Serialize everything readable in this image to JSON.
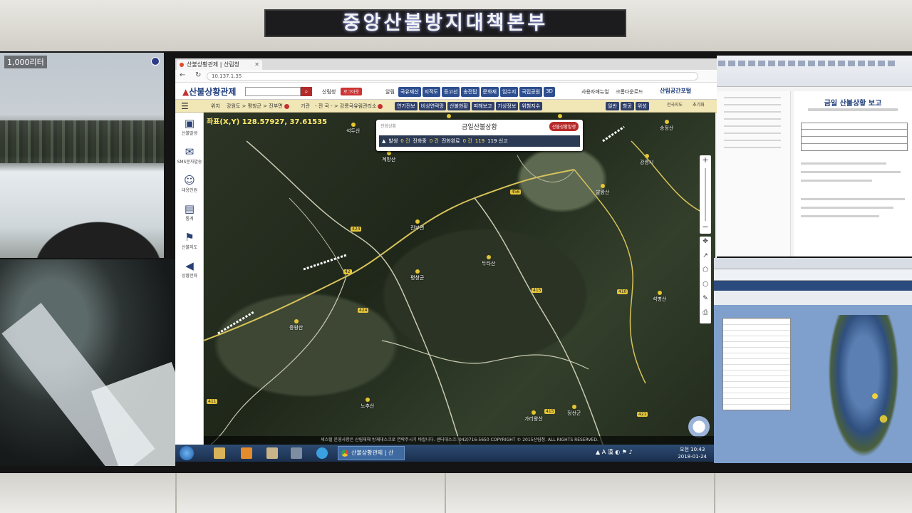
{
  "ticker": {
    "text": "중앙산불방지대책본부"
  },
  "camera": {
    "label": "1,000리터"
  },
  "browser": {
    "tab_title": "산불상황관제 | 산림청",
    "url": "10.137.1.35",
    "logo_main": "산불상황관제",
    "login_label": "산림청",
    "login_button": "로그아웃",
    "top_nav": [
      "알림",
      "국유재산",
      "지적도",
      "등고선",
      "송전탑",
      "문화재",
      "임수지",
      "국립공원",
      "3D"
    ],
    "util_links": [
      "사용자매뉴얼",
      "크롬다운로드"
    ],
    "portal": "산림공간포털",
    "location_label": "위치",
    "location_value": "강원도 > 평창군 > 진부면",
    "base_label": "기관",
    "base_value": "- 전 국 - > 강릉국유림관리소",
    "sub_nav": [
      "연기전보",
      "비상연락망",
      "산불현황",
      "피해보고",
      "기상정보",
      "위험지수"
    ],
    "sub_nav2": [
      "크로보기",
      "크로이동",
      "일반",
      "항공",
      "위성"
    ],
    "quick_links": [
      "전국지도",
      "초기화"
    ],
    "sidebar": [
      "산불발생",
      "SMS문자발송",
      "대응인원",
      "통계",
      "산불지도",
      "상황전파"
    ],
    "coord_text": "좌표(X,Y) 128.57927, 37.61535",
    "alert": {
      "tab": "진화상황",
      "title": "금일산불상황",
      "button": "산불상황발생",
      "items": [
        {
          "label": "발생",
          "count": "0 건"
        },
        {
          "label": "진화중",
          "count": "0 건"
        },
        {
          "label": "진화완료",
          "count": "0 건"
        },
        {
          "label": "119 신고",
          "count": "119"
        }
      ]
    },
    "places": [
      "석두산",
      "계방산",
      "오대산",
      "천마봉",
      "강릉시",
      "송정산",
      "발왕산",
      "진부면",
      "평창군",
      "두타산",
      "정선군",
      "가리왕산",
      "중왕산",
      "노추산",
      "석병산"
    ],
    "road_numbers": [
      "424",
      "424",
      "456",
      "415",
      "410",
      "42",
      "415",
      "421",
      "411"
    ],
    "copyright": "세스텔 운영사항은 산림재해 방재대스크로 연락주시기 바랍니다. 센터대스크: 042)716-5650 COPYRIGHT © 2015산림청. ALL RIGHTS RESERVED.",
    "taskbar_task": "산불상황관제 | 산",
    "clock_time": "오전 10:43",
    "clock_date": "2018-01-24"
  },
  "doc": {
    "title": "금일 산불상황 보고"
  },
  "colors": {
    "brand": "#1f3e7c",
    "alert_red": "#b82a2a",
    "nav_blue": "#2e4f8f"
  }
}
